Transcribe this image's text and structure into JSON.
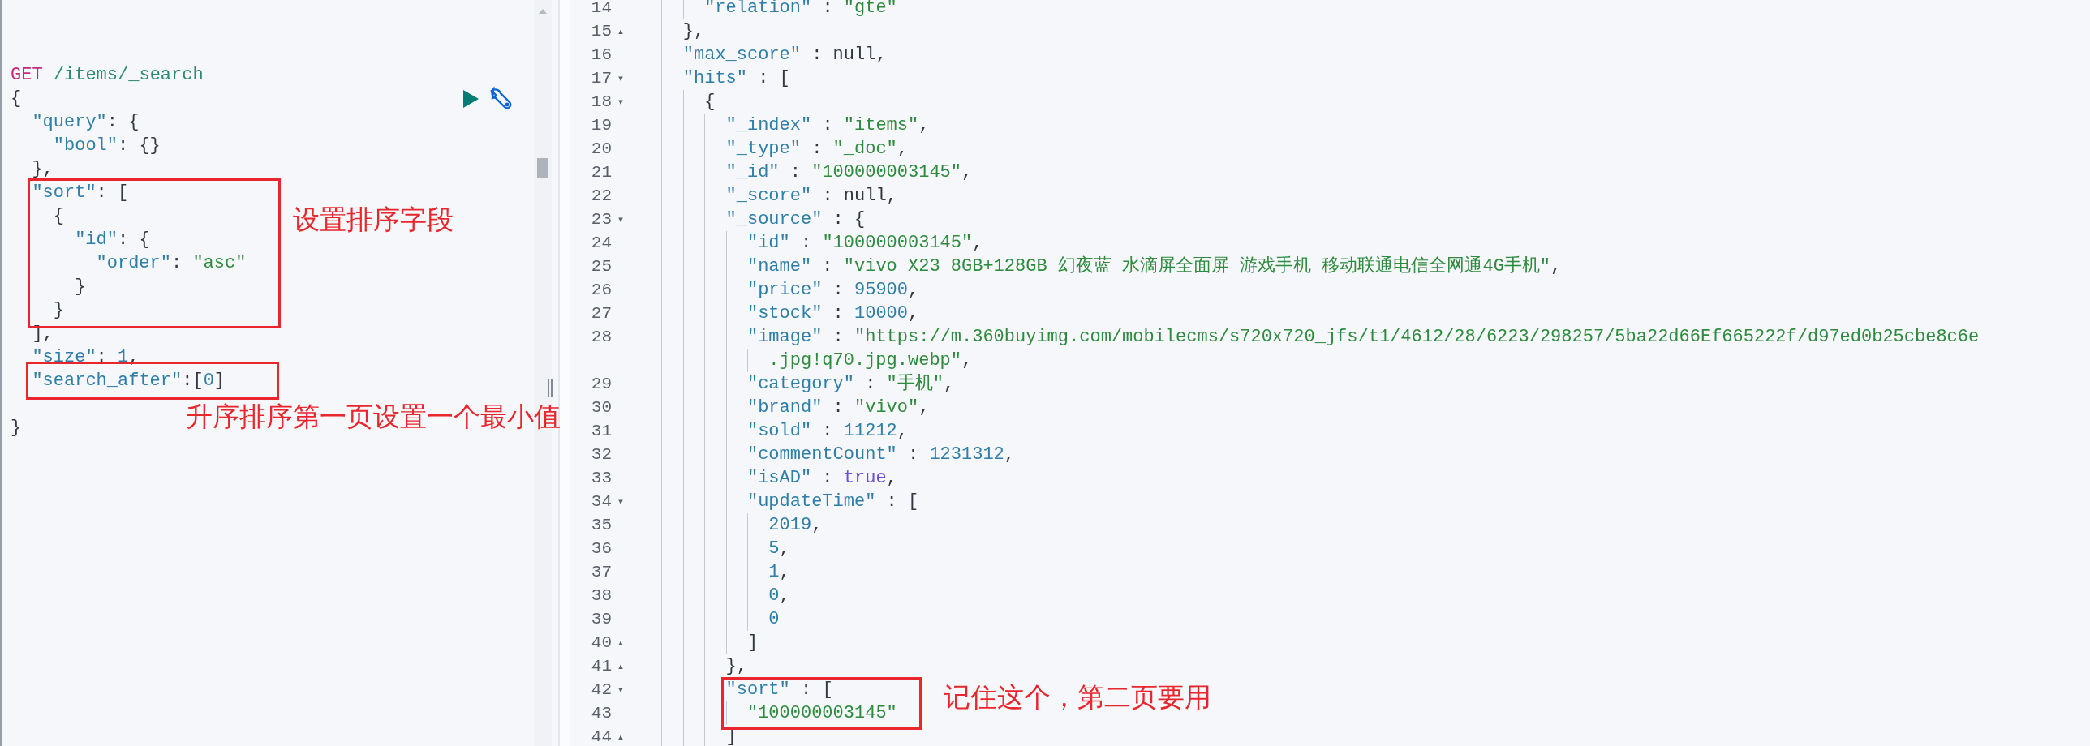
{
  "request_editor": {
    "lines": [
      {
        "tokens": [
          {
            "text": "GET",
            "kind": "method"
          },
          {
            "text": " /items/_search",
            "kind": "path"
          }
        ]
      },
      {
        "tokens": [
          {
            "text": "{",
            "kind": "punct"
          }
        ]
      },
      {
        "tokens": [
          {
            "text": "  \"query\"",
            "kind": "key"
          },
          {
            "text": ": {",
            "kind": "punct"
          }
        ]
      },
      {
        "tokens": [
          {
            "text": "    \"bool\"",
            "kind": "key"
          },
          {
            "text": ": {}",
            "kind": "punct"
          }
        ]
      },
      {
        "tokens": [
          {
            "text": "  },",
            "kind": "punct"
          }
        ]
      },
      {
        "tokens": [
          {
            "text": "  \"sort\"",
            "kind": "key"
          },
          {
            "text": ": [",
            "kind": "punct"
          }
        ]
      },
      {
        "tokens": [
          {
            "text": "    {",
            "kind": "punct"
          }
        ]
      },
      {
        "tokens": [
          {
            "text": "      \"id\"",
            "kind": "key"
          },
          {
            "text": ": {",
            "kind": "punct"
          }
        ]
      },
      {
        "tokens": [
          {
            "text": "        \"order\"",
            "kind": "key"
          },
          {
            "text": ": ",
            "kind": "punct"
          },
          {
            "text": "\"asc\"",
            "kind": "string"
          }
        ]
      },
      {
        "tokens": [
          {
            "text": "      }",
            "kind": "punct"
          }
        ]
      },
      {
        "tokens": [
          {
            "text": "    }",
            "kind": "punct"
          }
        ]
      },
      {
        "tokens": [
          {
            "text": "  ],",
            "kind": "punct"
          }
        ]
      },
      {
        "tokens": [
          {
            "text": "  \"size\"",
            "kind": "key"
          },
          {
            "text": ": ",
            "kind": "punct"
          },
          {
            "text": "1",
            "kind": "number"
          },
          {
            "text": ",",
            "kind": "punct"
          }
        ]
      },
      {
        "tokens": [
          {
            "text": "  \"search_after\"",
            "kind": "key"
          },
          {
            "text": ":[",
            "kind": "punct"
          },
          {
            "text": "0",
            "kind": "number"
          },
          {
            "text": "]",
            "kind": "punct"
          }
        ]
      },
      {
        "kind": "blank"
      },
      {
        "tokens": [
          {
            "text": "}",
            "kind": "punct"
          }
        ]
      }
    ]
  },
  "response_viewer": {
    "lines": [
      {
        "number": "14",
        "tokens": [
          {
            "text": "      \"relation\"",
            "kind": "key"
          },
          {
            "text": " : ",
            "kind": "punct"
          },
          {
            "text": "\"gte\"",
            "kind": "string"
          }
        ]
      },
      {
        "number": "15",
        "fold": "▴",
        "tokens": [
          {
            "text": "    },",
            "kind": "punct"
          }
        ]
      },
      {
        "number": "16",
        "tokens": [
          {
            "text": "    \"max_score\"",
            "kind": "key"
          },
          {
            "text": " : null,",
            "kind": "punct"
          }
        ]
      },
      {
        "number": "17",
        "fold": "▾",
        "tokens": [
          {
            "text": "    \"hits\"",
            "kind": "key"
          },
          {
            "text": " : [",
            "kind": "punct"
          }
        ]
      },
      {
        "number": "18",
        "fold": "▾",
        "tokens": [
          {
            "text": "      {",
            "kind": "punct"
          }
        ]
      },
      {
        "number": "19",
        "tokens": [
          {
            "text": "        \"_index\"",
            "kind": "key"
          },
          {
            "text": " : ",
            "kind": "punct"
          },
          {
            "text": "\"items\"",
            "kind": "string"
          },
          {
            "text": ",",
            "kind": "punct"
          }
        ]
      },
      {
        "number": "20",
        "tokens": [
          {
            "text": "        \"_type\"",
            "kind": "key"
          },
          {
            "text": " : ",
            "kind": "punct"
          },
          {
            "text": "\"_doc\"",
            "kind": "string"
          },
          {
            "text": ",",
            "kind": "punct"
          }
        ]
      },
      {
        "number": "21",
        "tokens": [
          {
            "text": "        \"_id\"",
            "kind": "key"
          },
          {
            "text": " : ",
            "kind": "punct"
          },
          {
            "text": "\"100000003145\"",
            "kind": "string"
          },
          {
            "text": ",",
            "kind": "punct"
          }
        ]
      },
      {
        "number": "22",
        "tokens": [
          {
            "text": "        \"_score\"",
            "kind": "key"
          },
          {
            "text": " : null,",
            "kind": "punct"
          }
        ]
      },
      {
        "number": "23",
        "fold": "▾",
        "tokens": [
          {
            "text": "        \"_source\"",
            "kind": "key"
          },
          {
            "text": " : {",
            "kind": "punct"
          }
        ]
      },
      {
        "number": "24",
        "tokens": [
          {
            "text": "          \"id\"",
            "kind": "key"
          },
          {
            "text": " : ",
            "kind": "punct"
          },
          {
            "text": "\"100000003145\"",
            "kind": "string"
          },
          {
            "text": ",",
            "kind": "punct"
          }
        ]
      },
      {
        "number": "25",
        "tokens": [
          {
            "text": "          \"name\"",
            "kind": "key"
          },
          {
            "text": " : ",
            "kind": "punct"
          },
          {
            "text": "\"vivo X23 8GB+128GB 幻夜蓝 水滴屏全面屏 游戏手机 移动联通电信全网通4G手机\"",
            "kind": "string"
          },
          {
            "text": ",",
            "kind": "punct"
          }
        ]
      },
      {
        "number": "26",
        "tokens": [
          {
            "text": "          \"price\"",
            "kind": "key"
          },
          {
            "text": " : ",
            "kind": "punct"
          },
          {
            "text": "95900",
            "kind": "number"
          },
          {
            "text": ",",
            "kind": "punct"
          }
        ]
      },
      {
        "number": "27",
        "tokens": [
          {
            "text": "          \"stock\"",
            "kind": "key"
          },
          {
            "text": " : ",
            "kind": "punct"
          },
          {
            "text": "10000",
            "kind": "number"
          },
          {
            "text": ",",
            "kind": "punct"
          }
        ]
      },
      {
        "number": "28",
        "tokens": [
          {
            "text": "          \"image\"",
            "kind": "key"
          },
          {
            "text": " : ",
            "kind": "punct"
          },
          {
            "text": "\"https://m.360buyimg.com/mobilecms/s720x720_jfs/t1/4612/28/6223/298257/5ba22d66Ef665222f/d97ed0b25cbe8c6e",
            "kind": "string"
          }
        ],
        "wrap": [
          {
            "text": "            .jpg!q70.jpg.webp\"",
            "kind": "string"
          },
          {
            "text": ",",
            "kind": "punct"
          }
        ]
      },
      {
        "number": "29",
        "tokens": [
          {
            "text": "          \"category\"",
            "kind": "key"
          },
          {
            "text": " : ",
            "kind": "punct"
          },
          {
            "text": "\"手机\"",
            "kind": "string"
          },
          {
            "text": ",",
            "kind": "punct"
          }
        ]
      },
      {
        "number": "30",
        "tokens": [
          {
            "text": "          \"brand\"",
            "kind": "key"
          },
          {
            "text": " : ",
            "kind": "punct"
          },
          {
            "text": "\"vivo\"",
            "kind": "string"
          },
          {
            "text": ",",
            "kind": "punct"
          }
        ]
      },
      {
        "number": "31",
        "tokens": [
          {
            "text": "          \"sold\"",
            "kind": "key"
          },
          {
            "text": " : ",
            "kind": "punct"
          },
          {
            "text": "11212",
            "kind": "number"
          },
          {
            "text": ",",
            "kind": "punct"
          }
        ]
      },
      {
        "number": "32",
        "tokens": [
          {
            "text": "          \"commentCount\"",
            "kind": "key"
          },
          {
            "text": " : ",
            "kind": "punct"
          },
          {
            "text": "1231312",
            "kind": "number"
          },
          {
            "text": ",",
            "kind": "punct"
          }
        ]
      },
      {
        "number": "33",
        "tokens": [
          {
            "text": "          \"isAD\"",
            "kind": "key"
          },
          {
            "text": " : ",
            "kind": "punct"
          },
          {
            "text": "true",
            "kind": "bool"
          },
          {
            "text": ",",
            "kind": "punct"
          }
        ]
      },
      {
        "number": "34",
        "fold": "▾",
        "tokens": [
          {
            "text": "          \"updateTime\"",
            "kind": "key"
          },
          {
            "text": " : [",
            "kind": "punct"
          }
        ]
      },
      {
        "number": "35",
        "tokens": [
          {
            "text": "            2019",
            "kind": "number"
          },
          {
            "text": ",",
            "kind": "punct"
          }
        ]
      },
      {
        "number": "36",
        "tokens": [
          {
            "text": "            5",
            "kind": "number"
          },
          {
            "text": ",",
            "kind": "punct"
          }
        ]
      },
      {
        "number": "37",
        "tokens": [
          {
            "text": "            1",
            "kind": "number"
          },
          {
            "text": ",",
            "kind": "punct"
          }
        ]
      },
      {
        "number": "38",
        "tokens": [
          {
            "text": "            0",
            "kind": "number"
          },
          {
            "text": ",",
            "kind": "punct"
          }
        ]
      },
      {
        "number": "39",
        "tokens": [
          {
            "text": "            0",
            "kind": "number"
          }
        ]
      },
      {
        "number": "40",
        "fold": "▴",
        "tokens": [
          {
            "text": "          ]",
            "kind": "punct"
          }
        ]
      },
      {
        "number": "41",
        "fold": "▴",
        "tokens": [
          {
            "text": "        },",
            "kind": "punct"
          }
        ]
      },
      {
        "number": "42",
        "fold": "▾",
        "tokens": [
          {
            "text": "        \"sort\"",
            "kind": "key"
          },
          {
            "text": " : [",
            "kind": "punct"
          }
        ]
      },
      {
        "number": "43",
        "tokens": [
          {
            "text": "          \"100000003145\"",
            "kind": "string"
          }
        ]
      },
      {
        "number": "44",
        "fold": "▴",
        "tokens": [
          {
            "text": "        ]",
            "kind": "punct"
          }
        ]
      }
    ]
  },
  "annotations": [
    {
      "text": "设置排序字段"
    },
    {
      "text": "升序排序第一页设置一个最小值"
    },
    {
      "text": "记住这个，第二页要用"
    }
  ]
}
